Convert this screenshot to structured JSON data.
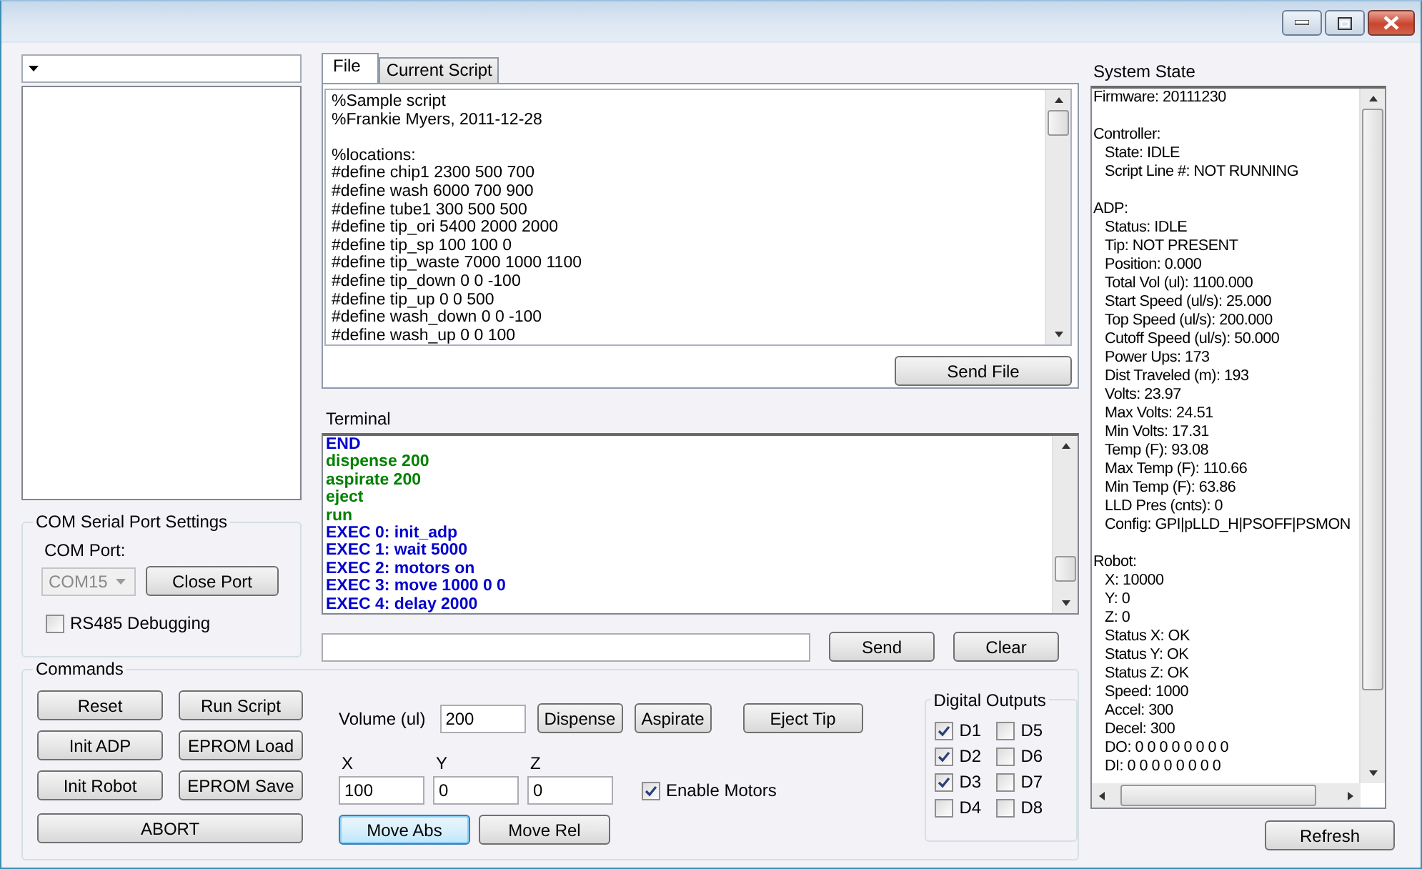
{
  "file_tabs": [
    {
      "label": "File",
      "selected": true
    },
    {
      "label": "Current Script",
      "selected": false
    }
  ],
  "script_blocks": [
    [
      "%Sample script",
      "%Frankie Myers, 2011-12-28"
    ],
    [
      "%locations:",
      "#define chip1 2300 500 700",
      "#define wash 6000 700 900",
      "#define tube1 300 500 500",
      "#define tip_ori 5400 2000 2000",
      "#define tip_sp 100 100 0",
      "#define tip_waste 7000 1000 1100",
      "#define tip_down 0 0 -100",
      "#define tip_up 0 0 500",
      "#define wash_down 0 0 -100",
      "#define wash_up 0 0 100"
    ]
  ],
  "send_file_button": "Send File",
  "terminal": {
    "label": "Terminal",
    "lines": [
      {
        "text": "END",
        "color": "#0000cc"
      },
      {
        "text": "dispense 200",
        "color": "#008000"
      },
      {
        "text": "aspirate 200",
        "color": "#008000"
      },
      {
        "text": "eject",
        "color": "#008000"
      },
      {
        "text": "run",
        "color": "#008000"
      },
      {
        "text": "EXEC 0: init_adp",
        "color": "#0000cc"
      },
      {
        "text": "EXEC 1: wait 5000",
        "color": "#0000cc"
      },
      {
        "text": "EXEC 2: motors on",
        "color": "#0000cc"
      },
      {
        "text": "EXEC 3: move 1000 0 0",
        "color": "#0000cc"
      },
      {
        "text": "EXEC 4: delay 2000",
        "color": "#0000cc"
      }
    ],
    "send_button": "Send",
    "clear_button": "Clear"
  },
  "com_settings": {
    "title": "COM Serial Port Settings",
    "port_label": "COM Port:",
    "port": {
      "value": "COM15",
      "disabled": true
    },
    "close_button": "Close Port",
    "rs485": {
      "label": "RS485 Debugging",
      "checked": false
    }
  },
  "commands": {
    "title": "Commands",
    "buttons": [
      "Reset",
      "Run Script",
      "Init ADP",
      "EPROM Load",
      "Init Robot",
      "EPROM Save"
    ],
    "abort_button": "ABORT",
    "volume": {
      "label": "Volume (ul)",
      "value": "200"
    },
    "volume_buttons": [
      "Dispense",
      "Aspirate"
    ],
    "eject_button": "Eject Tip",
    "axes": [
      {
        "label": "X",
        "value": "100"
      },
      {
        "label": "Y",
        "value": "0"
      },
      {
        "label": "Z",
        "value": "0"
      }
    ],
    "enable_motors": {
      "label": "Enable Motors",
      "checked": true
    },
    "move_buttons": [
      {
        "label": "Move Abs",
        "default": true
      },
      {
        "label": "Move Rel",
        "default": false
      }
    ],
    "digital_outputs": {
      "title": "Digital Outputs",
      "items": [
        {
          "label": "D1",
          "checked": true
        },
        {
          "label": "D2",
          "checked": true
        },
        {
          "label": "D3",
          "checked": true
        },
        {
          "label": "D4",
          "checked": false
        },
        {
          "label": "D5",
          "checked": false
        },
        {
          "label": "D6",
          "checked": false
        },
        {
          "label": "D7",
          "checked": false
        },
        {
          "label": "D8",
          "checked": false
        }
      ]
    }
  },
  "system_state": {
    "title": "System State",
    "sections": [
      {
        "heading": "Firmware: 20111230"
      },
      {
        "heading": "Controller:",
        "children": [
          "State: IDLE",
          "Script Line #: NOT RUNNING"
        ]
      },
      {
        "heading": "ADP:",
        "children": [
          "Status: IDLE",
          "Tip: NOT PRESENT",
          "Position: 0.000",
          "Total Vol (ul): 1100.000",
          "Start Speed (ul/s): 25.000",
          "Top Speed (ul/s): 200.000",
          "Cutoff Speed (ul/s): 50.000",
          "Power Ups: 173",
          "Dist Traveled (m): 193",
          "Volts: 23.97",
          "Max Volts: 24.51",
          "Min Volts: 17.31",
          "Temp (F): 93.08",
          "Max Temp (F): 110.66",
          "Min Temp (F): 63.86",
          "LLD Pres (cnts): 0",
          "Config: GPI|pLLD_H|PSOFF|PSMON"
        ]
      },
      {
        "heading": "Robot:",
        "children": [
          "X: 10000",
          "Y: 0",
          "Z: 0",
          "Status X: OK",
          "Status Y: OK",
          "Status Z: OK",
          "Speed: 1000",
          "Accel: 300",
          "Decel: 300",
          "DO: 0 0 0 0 0 0 0 0",
          "DI: 0 0 0 0 0 0 0 0"
        ]
      }
    ],
    "refresh_button": "Refresh"
  }
}
